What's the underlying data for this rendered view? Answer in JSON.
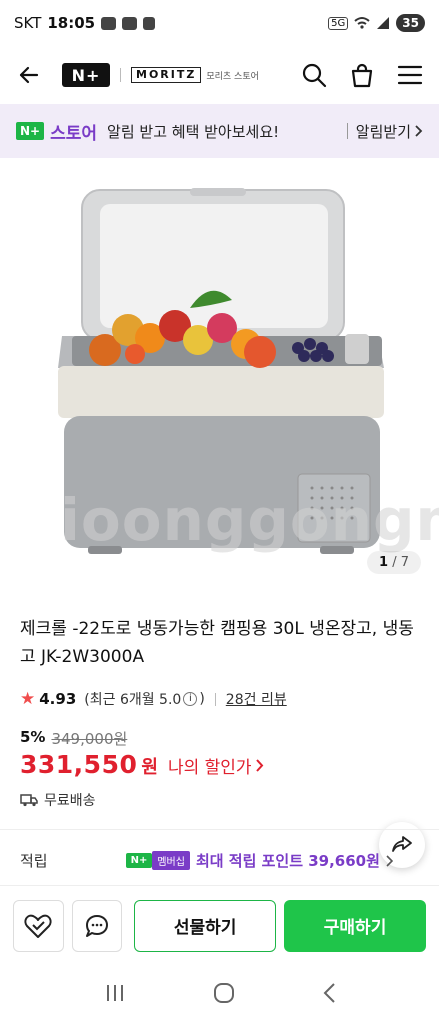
{
  "status_bar": {
    "carrier": "SKT",
    "time": "18:05",
    "network": "5G",
    "battery": "35"
  },
  "header": {
    "logo": "N+",
    "brand": "MORITZ",
    "brand_sub": "모리츠 스토어"
  },
  "banner": {
    "logo_badge": "N+",
    "logo_text": "스토어",
    "message": "알림 받고 혜택 받아보세요!",
    "link": "알림받기"
  },
  "image": {
    "watermark": "ioonggongm",
    "page_current": "1",
    "page_total": "/ 7"
  },
  "product": {
    "title": "제크롤 -22도로 냉동가능한 캠핑용 30L 냉온장고, 냉동고 JK-2W3000A",
    "rating": "4.93",
    "recent_rating": "(최근 6개월 5.0",
    "recent_rating_close": ")",
    "review_count": "28건 리뷰",
    "discount_rate": "5%",
    "original_price": "349,000원",
    "price": "331,550",
    "price_unit": "원",
    "my_price_label": "나의 할인가",
    "shipping": "무료배송",
    "points_label": "적립",
    "member_badge": "N+",
    "member_badge_sub": "멤버십",
    "points_text": "최대 적립 포인트 39,660원"
  },
  "actions": {
    "gift": "선물하기",
    "buy": "구매하기"
  },
  "colors": {
    "brand_green": "#1db546",
    "accent_purple": "#7a3cc7",
    "price_red": "#e0202e"
  }
}
